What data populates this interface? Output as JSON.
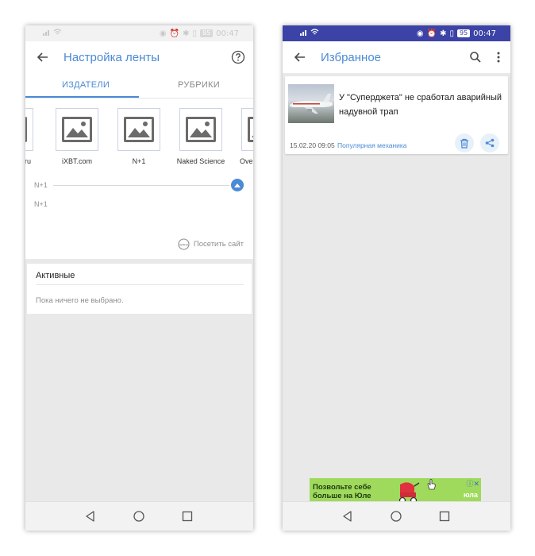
{
  "left_screen": {
    "status": {
      "time": "00:47",
      "battery": "95"
    },
    "appbar": {
      "title": "Настройка ленты"
    },
    "tabs": {
      "active": "ИЗДАТЕЛИ",
      "inactive": "РУБРИКИ"
    },
    "publishers": [
      {
        "name": "ru"
      },
      {
        "name": "iXBT.com"
      },
      {
        "name": "N+1"
      },
      {
        "name": "Naked Science"
      },
      {
        "name": "Ove"
      }
    ],
    "selected": {
      "slider_label": "N+1",
      "name": "N+1",
      "visit_label": "Посетить сайт"
    },
    "active_card": {
      "title": "Активные",
      "empty_text": "Пока ничего не выбрано."
    }
  },
  "right_screen": {
    "status": {
      "time": "00:47",
      "battery": "95"
    },
    "appbar": {
      "title": "Избранное"
    },
    "news": {
      "title": "У \"Суперджета\" не сработал аварийный надувной трап",
      "date": "15.02.20 09:05",
      "source": "Популярная механика"
    },
    "ad": {
      "line1": "Позвольте себе",
      "line2": "больше на Юле",
      "brand": "юла"
    }
  },
  "colors": {
    "accent": "#4a8ad6",
    "status_bar_right": "#3b43a6",
    "ad_background": "#9fda5c"
  }
}
